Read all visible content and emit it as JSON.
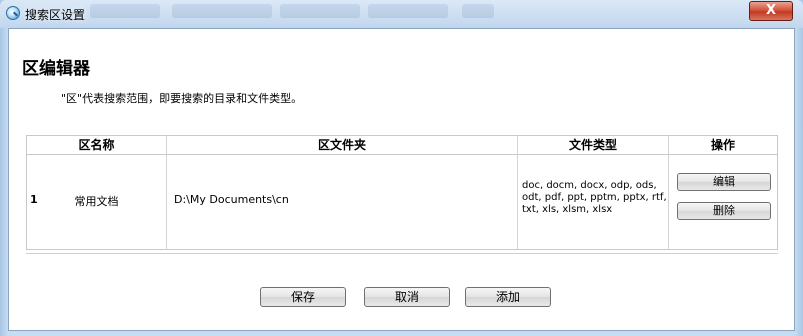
{
  "window": {
    "title": "搜索区设置",
    "close_glyph": "X"
  },
  "page": {
    "title": "区编辑器",
    "subtitle": "\"区\"代表搜索范围，即要搜索的目录和文件类型。"
  },
  "table": {
    "headers": [
      "区名称",
      "区文件夹",
      "文件类型",
      "操作"
    ],
    "rows": [
      {
        "index": "1",
        "name": "常用文档",
        "folder": "D:\\My Documents\\cn",
        "types_line1": "doc, docm, docx, odp, ods,",
        "types_line2": "odt, pdf, ppt, pptm, pptx, rtf,",
        "types_line3": "txt, xls, xlsm, xlsx",
        "edit_label": "编辑",
        "delete_label": "删除"
      }
    ]
  },
  "buttons": {
    "save": "保存",
    "cancel": "取消",
    "add": "添加"
  }
}
